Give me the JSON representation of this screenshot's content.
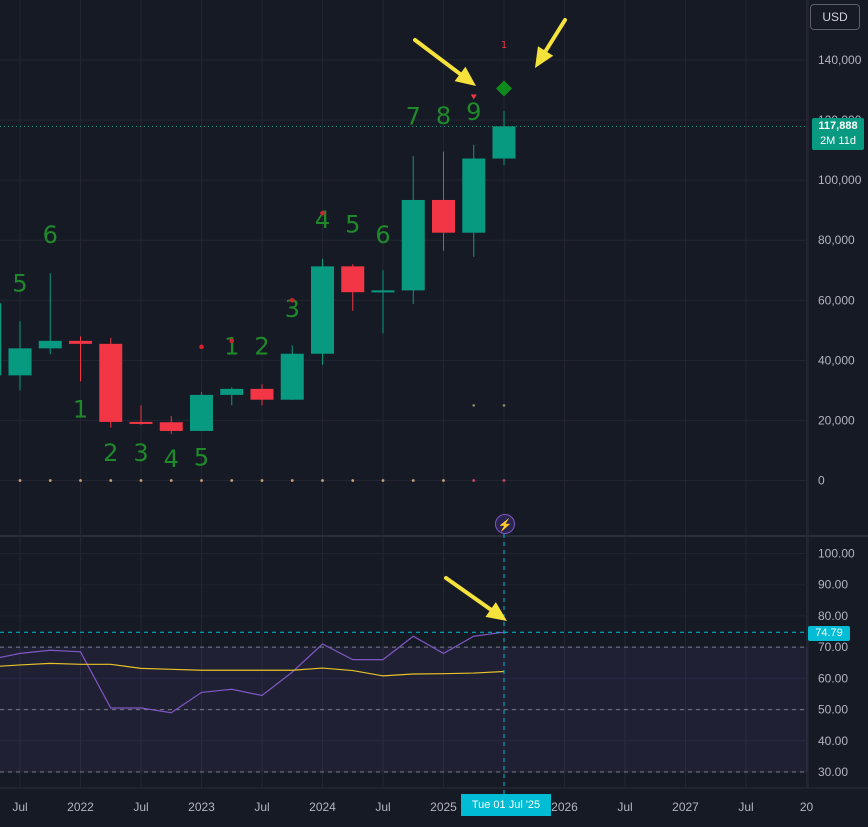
{
  "currency": "USD",
  "price_tag": {
    "price": "117,888",
    "countdown": "2M 11d"
  },
  "rsi_tag": "74.79",
  "crosshair_date": "Tue 01 Jul '25",
  "colors": {
    "bull": "#089981",
    "bear": "#f23645",
    "count": "#1f8a2a",
    "rsi": "#7e57c2",
    "rsi_ma": "#e6c229",
    "arrow": "#f5e23a",
    "crosshair": "#00bcd4"
  },
  "chart_data": [
    {
      "type": "candlestick",
      "title": "",
      "interval": "quarterly",
      "ylim": [
        -10000,
        150000
      ],
      "y_ticks": [
        0,
        20000,
        40000,
        60000,
        80000,
        100000,
        120000,
        140000
      ],
      "y_tick_labels": [
        "0",
        "20,000",
        "40,000",
        "60,000",
        "80,000",
        "100,000",
        "120,000",
        "140,000"
      ],
      "x_ticks": [
        {
          "i": 0,
          "label": "Jul"
        },
        {
          "i": 2,
          "label": "2022"
        },
        {
          "i": 4,
          "label": "Jul"
        },
        {
          "i": 6,
          "label": "2023"
        },
        {
          "i": 8,
          "label": "Jul"
        },
        {
          "i": 10,
          "label": "2024"
        },
        {
          "i": 12,
          "label": "Jul"
        },
        {
          "i": 14,
          "label": "2025"
        },
        {
          "i": 16,
          "label": ""
        },
        {
          "i": 18,
          "label": "2026"
        },
        {
          "i": 20,
          "label": "Jul"
        },
        {
          "i": 22,
          "label": "2027"
        },
        {
          "i": 24,
          "label": "Jul"
        },
        {
          "i": 26,
          "label": "20"
        }
      ],
      "candles": [
        {
          "i": -1,
          "o": 35000,
          "h": 59000,
          "l": 29000,
          "c": 59000
        },
        {
          "i": 0,
          "o": 35000,
          "h": 53000,
          "l": 30000,
          "c": 44000
        },
        {
          "i": 1,
          "o": 44000,
          "h": 69000,
          "l": 42000,
          "c": 46500
        },
        {
          "i": 2,
          "o": 46500,
          "h": 48000,
          "l": 33000,
          "c": 45500
        },
        {
          "i": 3,
          "o": 45500,
          "h": 47500,
          "l": 17600,
          "c": 19500
        },
        {
          "i": 4,
          "o": 19500,
          "h": 25000,
          "l": 18500,
          "c": 19400
        },
        {
          "i": 5,
          "o": 19400,
          "h": 21500,
          "l": 15500,
          "c": 16500
        },
        {
          "i": 6,
          "o": 16500,
          "h": 29500,
          "l": 16500,
          "c": 28500
        },
        {
          "i": 7,
          "o": 28500,
          "h": 31000,
          "l": 25000,
          "c": 30500
        },
        {
          "i": 8,
          "o": 30500,
          "h": 32000,
          "l": 25000,
          "c": 26900
        },
        {
          "i": 9,
          "o": 26900,
          "h": 45000,
          "l": 26800,
          "c": 42200
        },
        {
          "i": 10,
          "o": 42200,
          "h": 73800,
          "l": 38500,
          "c": 71300
        },
        {
          "i": 11,
          "o": 71300,
          "h": 72000,
          "l": 56500,
          "c": 62700
        },
        {
          "i": 12,
          "o": 62700,
          "h": 70000,
          "l": 49000,
          "c": 63300
        },
        {
          "i": 13,
          "o": 63300,
          "h": 108000,
          "l": 58800,
          "c": 93400
        },
        {
          "i": 14,
          "o": 93400,
          "h": 109500,
          "l": 76500,
          "c": 82500
        },
        {
          "i": 15,
          "o": 82500,
          "h": 111800,
          "l": 74500,
          "c": 107200
        },
        {
          "i": 16,
          "o": 107200,
          "h": 123000,
          "l": 105000,
          "c": 117888
        }
      ],
      "current_price": 117888,
      "td_counts": [
        {
          "i": 0,
          "label": "5",
          "value": 63000
        },
        {
          "i": 1,
          "label": "6",
          "value": 79000
        },
        {
          "i": 2,
          "label": "1",
          "value": 21000
        },
        {
          "i": 3,
          "label": "2",
          "value": 6500
        },
        {
          "i": 4,
          "label": "3",
          "value": 6500
        },
        {
          "i": 5,
          "label": "4",
          "value": 4500
        },
        {
          "i": 6,
          "label": "5",
          "value": 5000
        },
        {
          "i": 7,
          "label": "1",
          "value": 42000
        },
        {
          "i": 8,
          "label": "2",
          "value": 42000
        },
        {
          "i": 9,
          "label": "3",
          "value": 54500
        },
        {
          "i": 10,
          "label": "4",
          "value": 84000
        },
        {
          "i": 11,
          "label": "5",
          "value": 82500
        },
        {
          "i": 12,
          "label": "6",
          "value": 79000
        },
        {
          "i": 13,
          "label": "7",
          "value": 118500
        },
        {
          "i": 14,
          "label": "8",
          "value": 118700
        },
        {
          "i": 15,
          "label": "9",
          "value": 120000
        },
        {
          "i": 16,
          "label": "1",
          "value": 144000
        }
      ],
      "red_dots": [
        {
          "i": 6,
          "value": 44500
        },
        {
          "i": 7,
          "value": 46500
        },
        {
          "i": 9,
          "value": 60000
        },
        {
          "i": 10,
          "value": 89000
        },
        {
          "i": 15,
          "value": 127500
        }
      ],
      "diamond_marker": {
        "i": 16,
        "value": 130500
      },
      "zero_dots": [
        -1,
        0,
        1,
        2,
        3,
        4,
        5,
        6,
        7,
        8,
        9,
        10,
        11,
        12,
        13,
        14,
        15,
        16
      ]
    },
    {
      "type": "line",
      "title": "",
      "ylim": [
        25,
        105
      ],
      "y_ticks": [
        30,
        40,
        50,
        60,
        70,
        80,
        90,
        100
      ],
      "y_tick_labels": [
        "30.00",
        "40.00",
        "50.00",
        "60.00",
        "70.00",
        "80.00",
        "90.00",
        "100.00"
      ],
      "bands": [
        30,
        50,
        70
      ],
      "series": [
        {
          "x": [
            -1,
            0,
            1,
            2,
            3,
            4,
            5,
            6,
            7,
            8,
            9,
            10,
            11,
            12,
            13,
            14,
            15,
            16
          ],
          "values": [
            66,
            68,
            69,
            68.5,
            50.5,
            50.5,
            49,
            55.5,
            56.5,
            54.5,
            62,
            71,
            66,
            66,
            73.5,
            68,
            73.5,
            74.79
          ]
        },
        {
          "x": [
            -1,
            0,
            1,
            2,
            3,
            4,
            5,
            6,
            7,
            8,
            9,
            10,
            11,
            12,
            13,
            14,
            15,
            16
          ],
          "values": [
            63.7,
            64.3,
            64.8,
            64.5,
            64.5,
            63.2,
            62.9,
            62.6,
            62.6,
            62.6,
            62.6,
            63.3,
            62.5,
            60.8,
            61.4,
            61.5,
            61.7,
            62.2
          ]
        }
      ]
    }
  ]
}
